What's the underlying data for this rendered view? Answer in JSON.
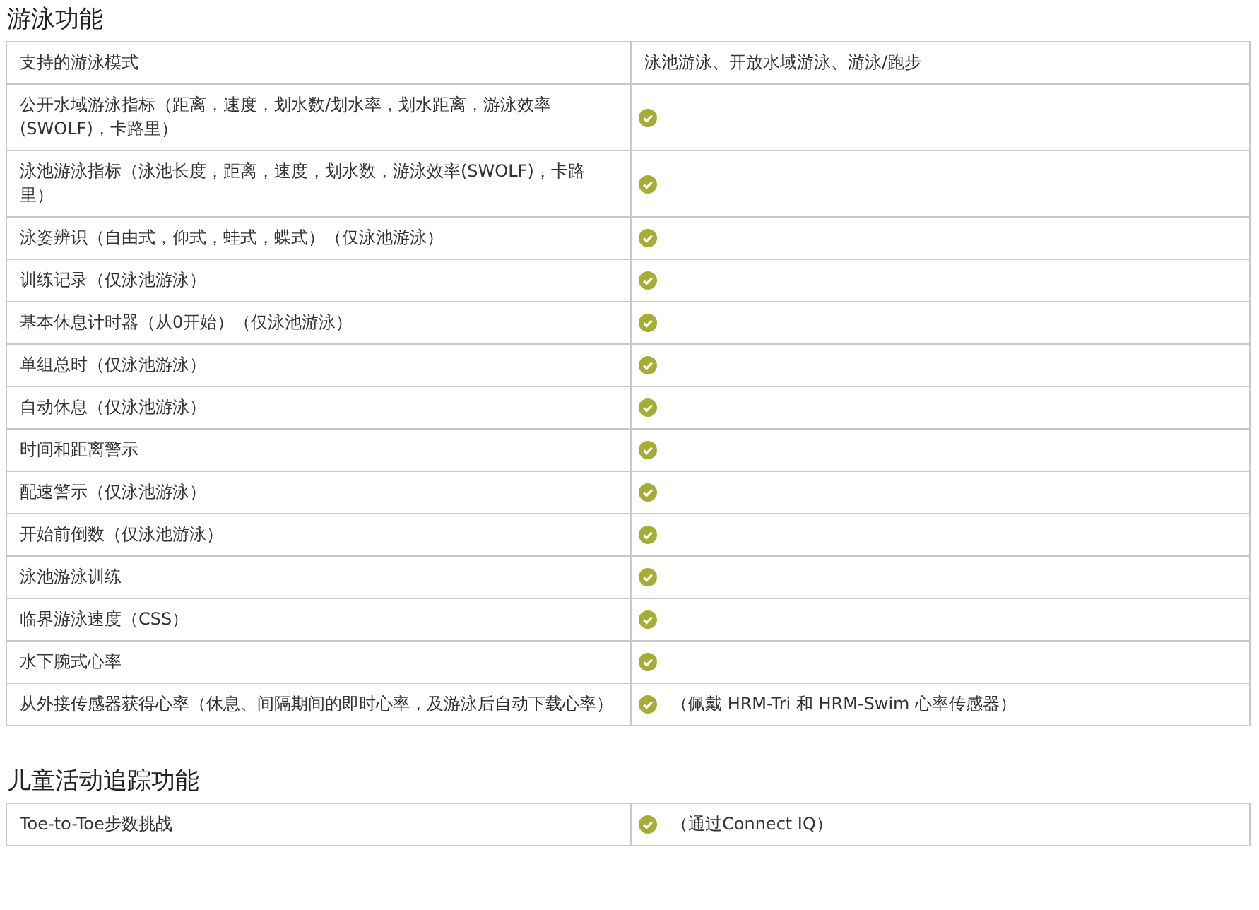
{
  "sections": [
    {
      "title": "游泳功能",
      "table": {
        "header": {
          "feature": "支持的游泳模式",
          "value": "泳池游泳、开放水域游泳、游泳/跑步"
        },
        "rows": [
          {
            "feature": "公开水域游泳指标（距离，速度，划水数/划水率，划水距离，游泳效率(SWOLF)，卡路里）",
            "supported": true
          },
          {
            "feature": "泳池游泳指标（泳池长度，距离，速度，划水数，游泳效率(SWOLF)，卡路里）",
            "supported": true
          },
          {
            "feature": "泳姿辨识（自由式，仰式，蛙式，蝶式）（仅泳池游泳）",
            "supported": true
          },
          {
            "feature": "训练记录（仅泳池游泳）",
            "supported": true
          },
          {
            "feature": "基本休息计时器（从0开始）（仅泳池游泳）",
            "supported": true
          },
          {
            "feature": "单组总时（仅泳池游泳）",
            "supported": true
          },
          {
            "feature": "自动休息（仅泳池游泳）",
            "supported": true
          },
          {
            "feature": "时间和距离警示",
            "supported": true
          },
          {
            "feature": "配速警示（仅泳池游泳）",
            "supported": true
          },
          {
            "feature": "开始前倒数（仅泳池游泳）",
            "supported": true
          },
          {
            "feature": "泳池游泳训练",
            "supported": true
          },
          {
            "feature": "临界游泳速度（CSS）",
            "supported": true
          },
          {
            "feature": "水下腕式心率",
            "supported": true
          },
          {
            "feature": "从外接传感器获得心率（休息、间隔期间的即时心率，及游泳后自动下载心率）",
            "supported": true,
            "note": "（佩戴 HRM-Tri 和 HRM-Swim 心率传感器）"
          }
        ]
      }
    },
    {
      "title": "儿童活动追踪功能",
      "table": {
        "rows": [
          {
            "feature": "Toe-to-Toe步数挑战",
            "supported": true,
            "note": "（通过Connect IQ）"
          }
        ]
      }
    }
  ]
}
